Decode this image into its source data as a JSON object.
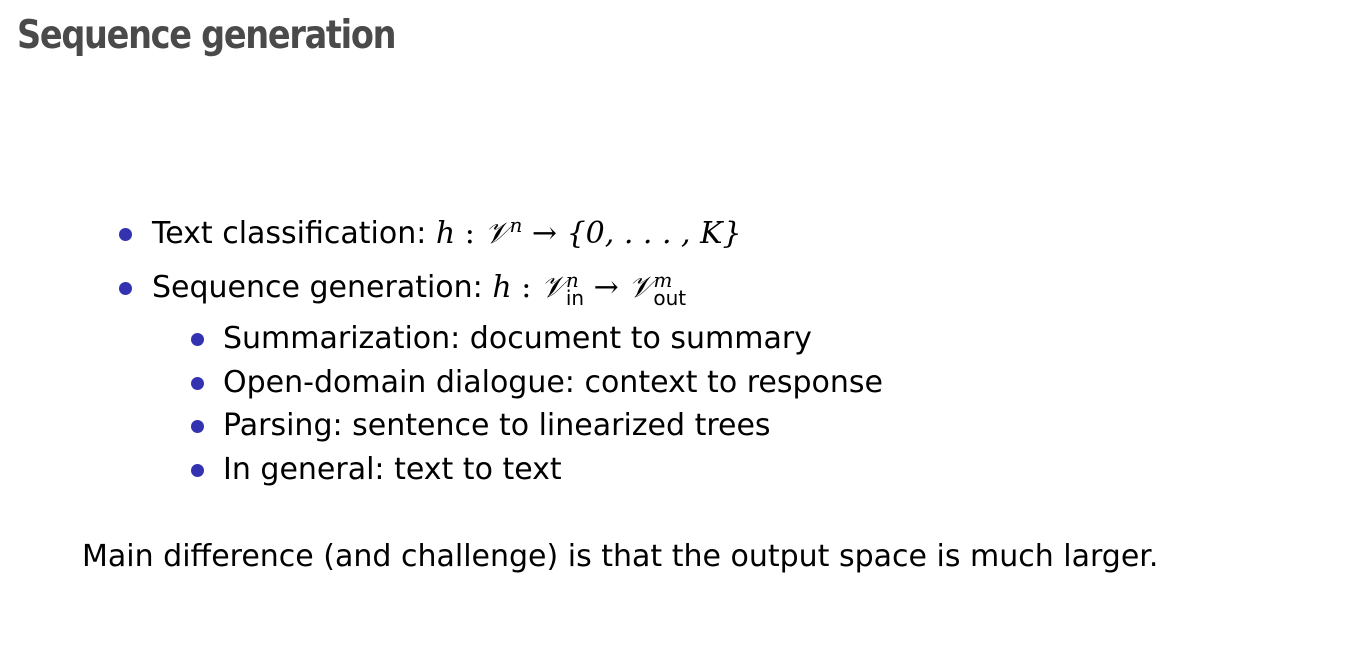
{
  "slide": {
    "title": "Sequence generation",
    "bullets": [
      {
        "label": "Text classification:",
        "math": {
          "func": "h",
          "colon": ":",
          "domain": "𝒱",
          "domain_sup": "n",
          "arrow": "→",
          "codomain": "{0, . . . , K}"
        }
      },
      {
        "label": "Sequence generation:",
        "math": {
          "func": "h",
          "colon": ":",
          "domain": "𝒱",
          "domain_sup": "n",
          "domain_sub": "in",
          "arrow": "→",
          "codomain": "𝒱",
          "codomain_sup": "m",
          "codomain_sub": "out"
        },
        "subitems": [
          "Summarization: document to summary",
          "Open-domain dialogue: context to response",
          "Parsing: sentence to linearized trees",
          "In general: text to text"
        ]
      }
    ],
    "note": "Main difference (and challenge) is that the output space is much larger.",
    "colors": {
      "title": "#4a4a4a",
      "bullet": "#3333b2",
      "text": "#000000"
    }
  }
}
